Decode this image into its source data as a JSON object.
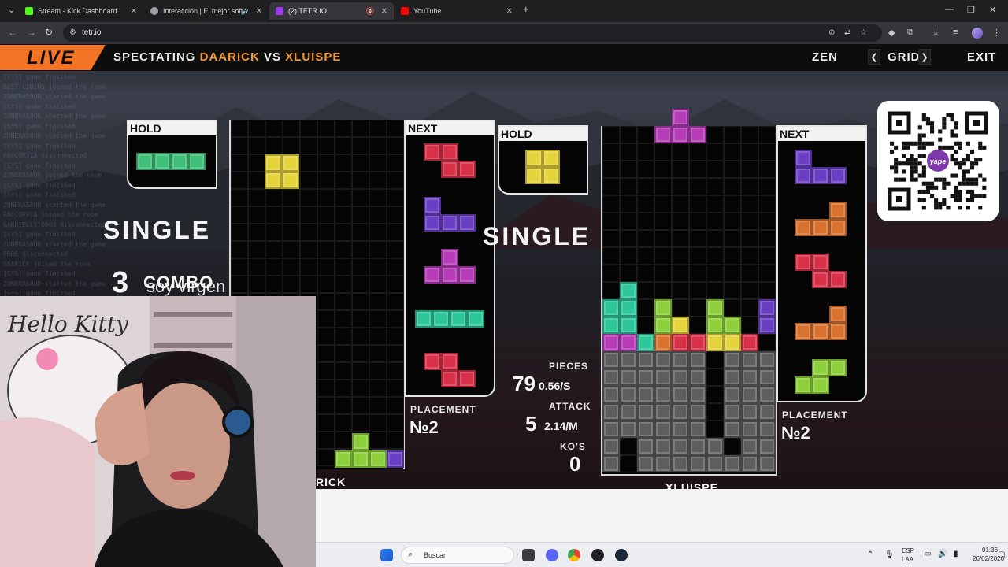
{
  "browser": {
    "tabs": [
      {
        "title": "Stream - Kick Dashboard",
        "icon": "kick-icon",
        "color": "#53fc18"
      },
      {
        "title": "Interacción | El mejor softw",
        "icon": "globe-icon",
        "color": "#9aa0a6"
      },
      {
        "title": "(2) TETR.IO",
        "icon": "tetrio-icon",
        "color": "#a13df0"
      },
      {
        "title": "YouTube",
        "icon": "youtube-icon",
        "color": "#ff0000"
      }
    ],
    "url": "tetr.io"
  },
  "game": {
    "live_label": "LIVE",
    "spectating_prefix": "SPECTATING",
    "player1": "DAARICK",
    "vs": "VS",
    "player2": "XLUISPE",
    "buttons": {
      "zen": "ZEN",
      "grid": "GRID",
      "exit": "EXIT"
    },
    "left": {
      "hold_label": "HOLD",
      "next_label": "NEXT",
      "clear_text": "SINGLE",
      "combo_count": "3",
      "combo_label": "COMBO",
      "placement_label": "PLACEMENT",
      "placement_value": "№2",
      "name_partial": "RICK"
    },
    "right": {
      "hold_label": "HOLD",
      "next_label": "NEXT",
      "clear_text": "SINGLE",
      "pieces_label": "PIECES",
      "pieces_value": "79",
      "pieces_rate": "0.56/S",
      "attack_label": "ATTACK",
      "attack_value": "5",
      "attack_rate": "2.14/M",
      "kos_label": "KO'S",
      "kos_value": "0",
      "placement_label": "PLACEMENT",
      "placement_value": "№2",
      "name": "XLUISPE"
    },
    "colors": {
      "accent": "#f37424",
      "player": "#f59a2f"
    }
  },
  "overlay_caption": "soy virgen",
  "taskbar": {
    "search_placeholder": "Buscar",
    "lang": "ESP",
    "lang2": "LAA",
    "time": "01:36",
    "date": "26/02/2026"
  }
}
